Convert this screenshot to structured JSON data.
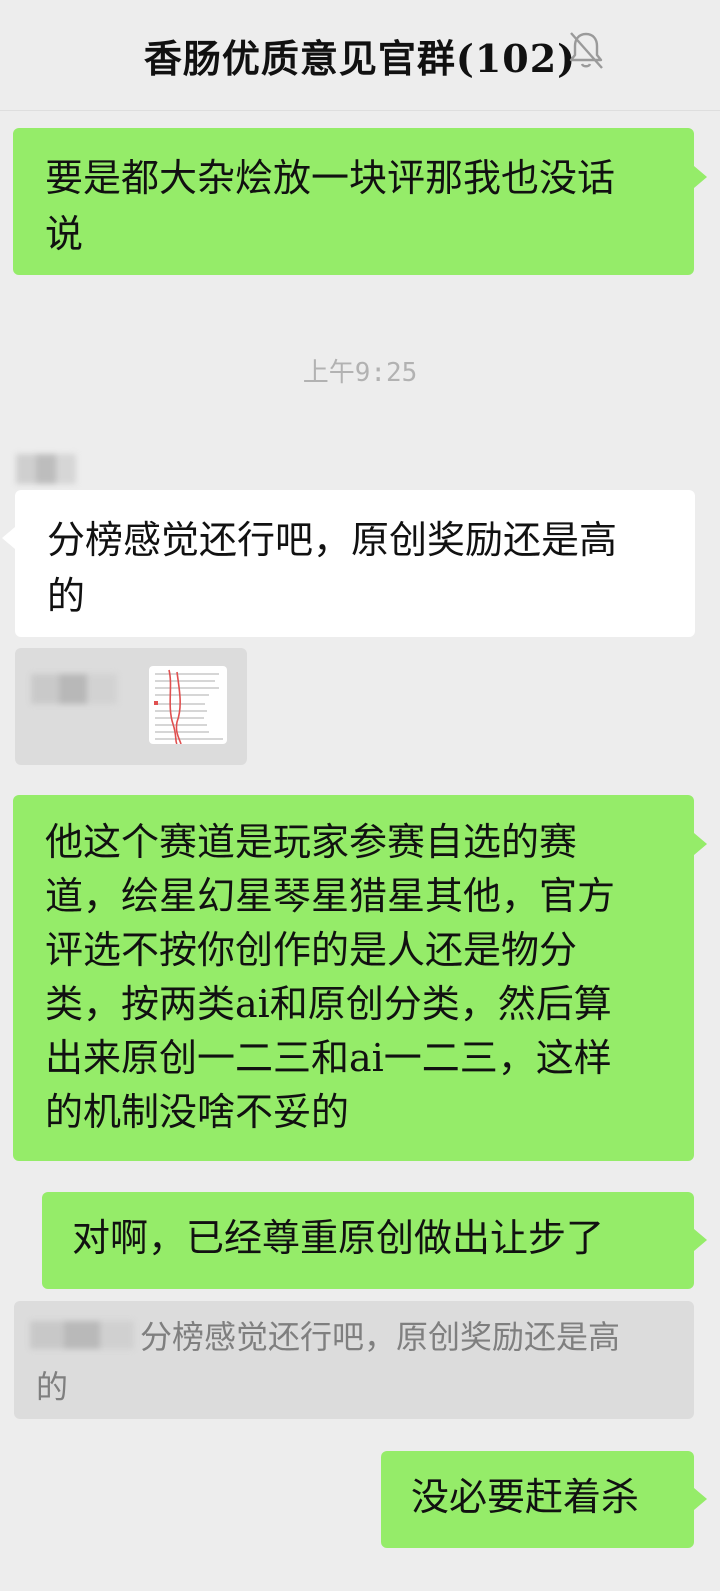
{
  "header": {
    "title": "香肠优质意见官群(102)",
    "mute_icon": "bell-slash-icon"
  },
  "messages": {
    "m1": {
      "line1": "要是都大杂烩放一块评那我也没话",
      "line2": "说"
    },
    "timestamp": "上午9:25",
    "m2": {
      "line1": "分榜感觉还行吧，原创奖励还是高",
      "line2": "的"
    },
    "m3": {
      "line1": "他这个赛道是玩家参赛自选的赛",
      "line2": "道，绘星幻星琴星猎星其他，官方",
      "line3": "评选不按你创作的是人还是物分",
      "line4": "类，按两类ai和原创分类，然后算",
      "line5": "出来原创一二三和ai一二三，这样",
      "line6": "的机制没啥不妥的"
    },
    "m4": {
      "text": "对啊，已经尊重原创做出让步了"
    },
    "m4_quote": {
      "line1": "分榜感觉还行吧，原创奖励还是高",
      "line2": "的"
    },
    "m5": {
      "text": "没必要赶着杀"
    }
  },
  "colors": {
    "background": "#ededed",
    "green_bubble": "#95ec69",
    "white_bubble": "#ffffff",
    "timestamp": "#b2b2b2",
    "quote_background": "#dcdcdc"
  }
}
